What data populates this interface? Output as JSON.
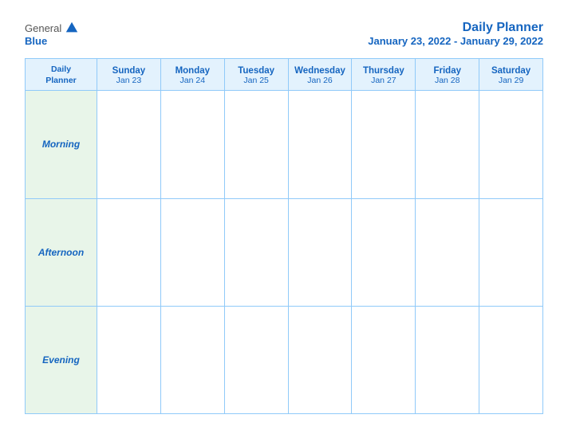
{
  "logo": {
    "general": "General",
    "blue": "Blue"
  },
  "title": {
    "main": "Daily Planner",
    "date_range": "January 23, 2022 - January 29, 2022"
  },
  "header": {
    "label_line1": "Daily",
    "label_line2": "Planner",
    "columns": [
      {
        "day": "Sunday",
        "date": "Jan 23"
      },
      {
        "day": "Monday",
        "date": "Jan 24"
      },
      {
        "day": "Tuesday",
        "date": "Jan 25"
      },
      {
        "day": "Wednesday",
        "date": "Jan 26"
      },
      {
        "day": "Thursday",
        "date": "Jan 27"
      },
      {
        "day": "Friday",
        "date": "Jan 28"
      },
      {
        "day": "Saturday",
        "date": "Jan 29"
      }
    ]
  },
  "rows": [
    {
      "label": "Morning"
    },
    {
      "label": "Afternoon"
    },
    {
      "label": "Evening"
    }
  ]
}
